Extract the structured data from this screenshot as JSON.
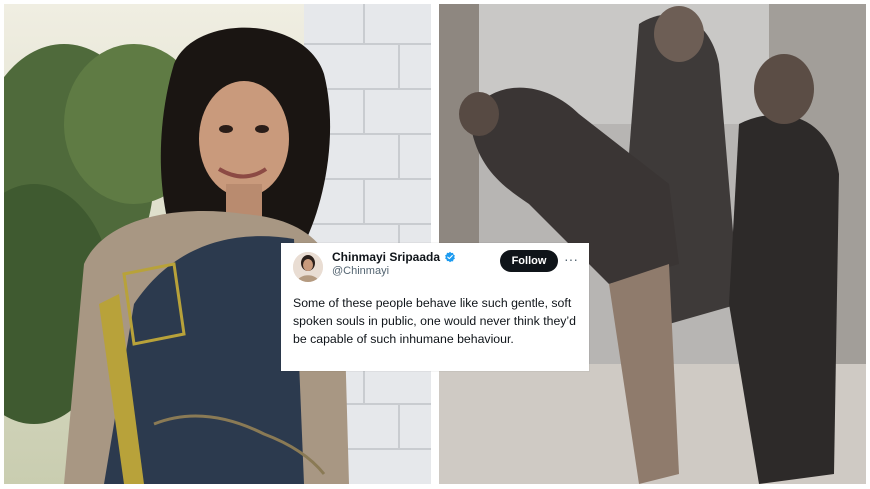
{
  "tweet": {
    "display_name": "Chinmayi Sripaada",
    "handle": "@Chinmayi",
    "follow_label": "Follow",
    "more_label": "···",
    "text": "Some of these people behave like such gentle, soft spoken souls in public, one would never think they’d be capable of such inhumane behaviour."
  },
  "images": {
    "left": {
      "subject": "woman in saree leaning on white brick wall"
    },
    "right": {
      "subject": "cctv still of physical assault in corridor"
    }
  },
  "colors": {
    "follow_button": "#0f1419",
    "verified_badge": "#1d9bf0",
    "handle": "#536471"
  }
}
